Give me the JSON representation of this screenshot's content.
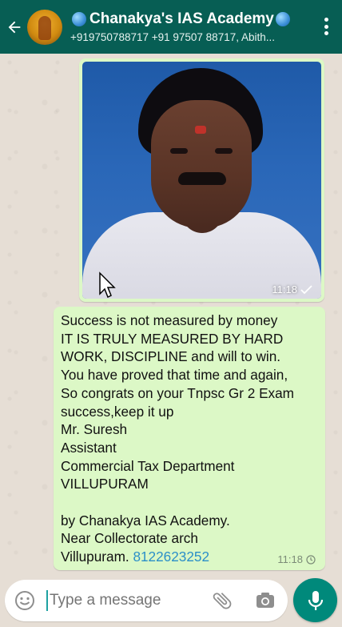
{
  "header": {
    "title": "Chanakya's IAS Academy",
    "subtitle": "+919750788717 +91 97507 88717, Abith..."
  },
  "image_message": {
    "time": "11:18"
  },
  "text_message": {
    "body": "Success is not measured by money\nIT IS TRULY MEASURED BY HARD WORK, DISCIPLINE and will to win.\nYou have proved that time and again,\nSo congrats on your Tnpsc Gr 2 Exam success,keep it up\nMr. Suresh\nAssistant\nCommercial Tax Department\nVILLUPURAM\n\nby Chanakya IAS Academy.\nNear Collectorate arch\nVillupuram. ",
    "phone": "8122623252",
    "time": "11:18"
  },
  "input": {
    "placeholder": "Type a message"
  },
  "colors": {
    "header": "#075e54",
    "bubble_out": "#dcf8c6",
    "link": "#2b8fc8",
    "fab": "#00897b"
  },
  "icons": [
    "back-arrow-icon",
    "globe-icon",
    "more-vert-icon",
    "cursor-icon",
    "double-check-icon",
    "clock-icon",
    "emoji-icon",
    "attach-icon",
    "camera-icon",
    "mic-icon"
  ]
}
